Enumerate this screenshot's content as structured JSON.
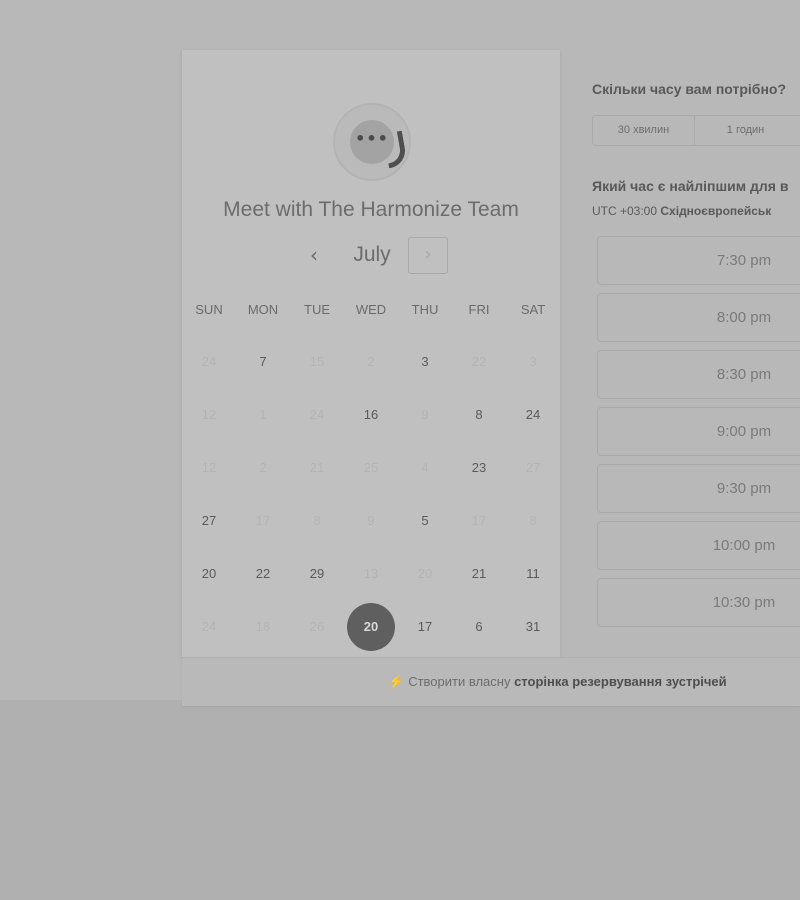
{
  "calendar": {
    "title": "Meet with The Harmonize Team",
    "logo_text": "•••",
    "month": "July",
    "prev_icon": "chevron-left-icon",
    "next_icon": "chevron-right-icon",
    "weekdays": [
      "SUN",
      "MON",
      "TUE",
      "WED",
      "THU",
      "FRI",
      "SAT"
    ],
    "weeks": [
      [
        {
          "d": "24",
          "s": "muted"
        },
        {
          "d": "7",
          "s": "avail"
        },
        {
          "d": "15",
          "s": "muted"
        },
        {
          "d": "2",
          "s": "muted"
        },
        {
          "d": "3",
          "s": "avail"
        },
        {
          "d": "22",
          "s": "muted"
        },
        {
          "d": "3",
          "s": "muted"
        }
      ],
      [
        {
          "d": "12",
          "s": "muted"
        },
        {
          "d": "1",
          "s": "muted"
        },
        {
          "d": "24",
          "s": "muted"
        },
        {
          "d": "16",
          "s": "avail"
        },
        {
          "d": "9",
          "s": "muted"
        },
        {
          "d": "8",
          "s": "avail"
        },
        {
          "d": "24",
          "s": "avail"
        }
      ],
      [
        {
          "d": "12",
          "s": "muted"
        },
        {
          "d": "2",
          "s": "muted"
        },
        {
          "d": "21",
          "s": "muted"
        },
        {
          "d": "25",
          "s": "muted"
        },
        {
          "d": "4",
          "s": "muted"
        },
        {
          "d": "23",
          "s": "avail"
        },
        {
          "d": "27",
          "s": "muted"
        }
      ],
      [
        {
          "d": "27",
          "s": "avail"
        },
        {
          "d": "17",
          "s": "muted"
        },
        {
          "d": "8",
          "s": "muted"
        },
        {
          "d": "9",
          "s": "muted"
        },
        {
          "d": "5",
          "s": "avail"
        },
        {
          "d": "17",
          "s": "muted"
        },
        {
          "d": "8",
          "s": "muted"
        }
      ],
      [
        {
          "d": "20",
          "s": "avail"
        },
        {
          "d": "22",
          "s": "avail"
        },
        {
          "d": "29",
          "s": "avail"
        },
        {
          "d": "13",
          "s": "muted"
        },
        {
          "d": "20",
          "s": "muted"
        },
        {
          "d": "21",
          "s": "avail"
        },
        {
          "d": "11",
          "s": "avail"
        }
      ],
      [
        {
          "d": "24",
          "s": "muted"
        },
        {
          "d": "18",
          "s": "muted"
        },
        {
          "d": "26",
          "s": "muted"
        },
        {
          "d": "20",
          "s": "selected"
        },
        {
          "d": "17",
          "s": "avail"
        },
        {
          "d": "6",
          "s": "avail"
        },
        {
          "d": "31",
          "s": "avail"
        }
      ]
    ]
  },
  "booking": {
    "duration_question": "Скільки часу вам потрібно?",
    "durations": [
      "30 хвилин",
      "1 годин"
    ],
    "time_question": "Який час є найліпшим для в",
    "timezone_prefix": "UTC +03:00",
    "timezone_name": "Східноєвропейськ",
    "slots": [
      "7:30 pm",
      "8:00 pm",
      "8:30 pm",
      "9:00 pm",
      "9:30 pm",
      "10:00 pm",
      "10:30 pm"
    ]
  },
  "footer": {
    "icon": "magic-wand-icon",
    "text_prefix": "Створити власну",
    "text_bold": "сторінка резервування зустрічей"
  }
}
